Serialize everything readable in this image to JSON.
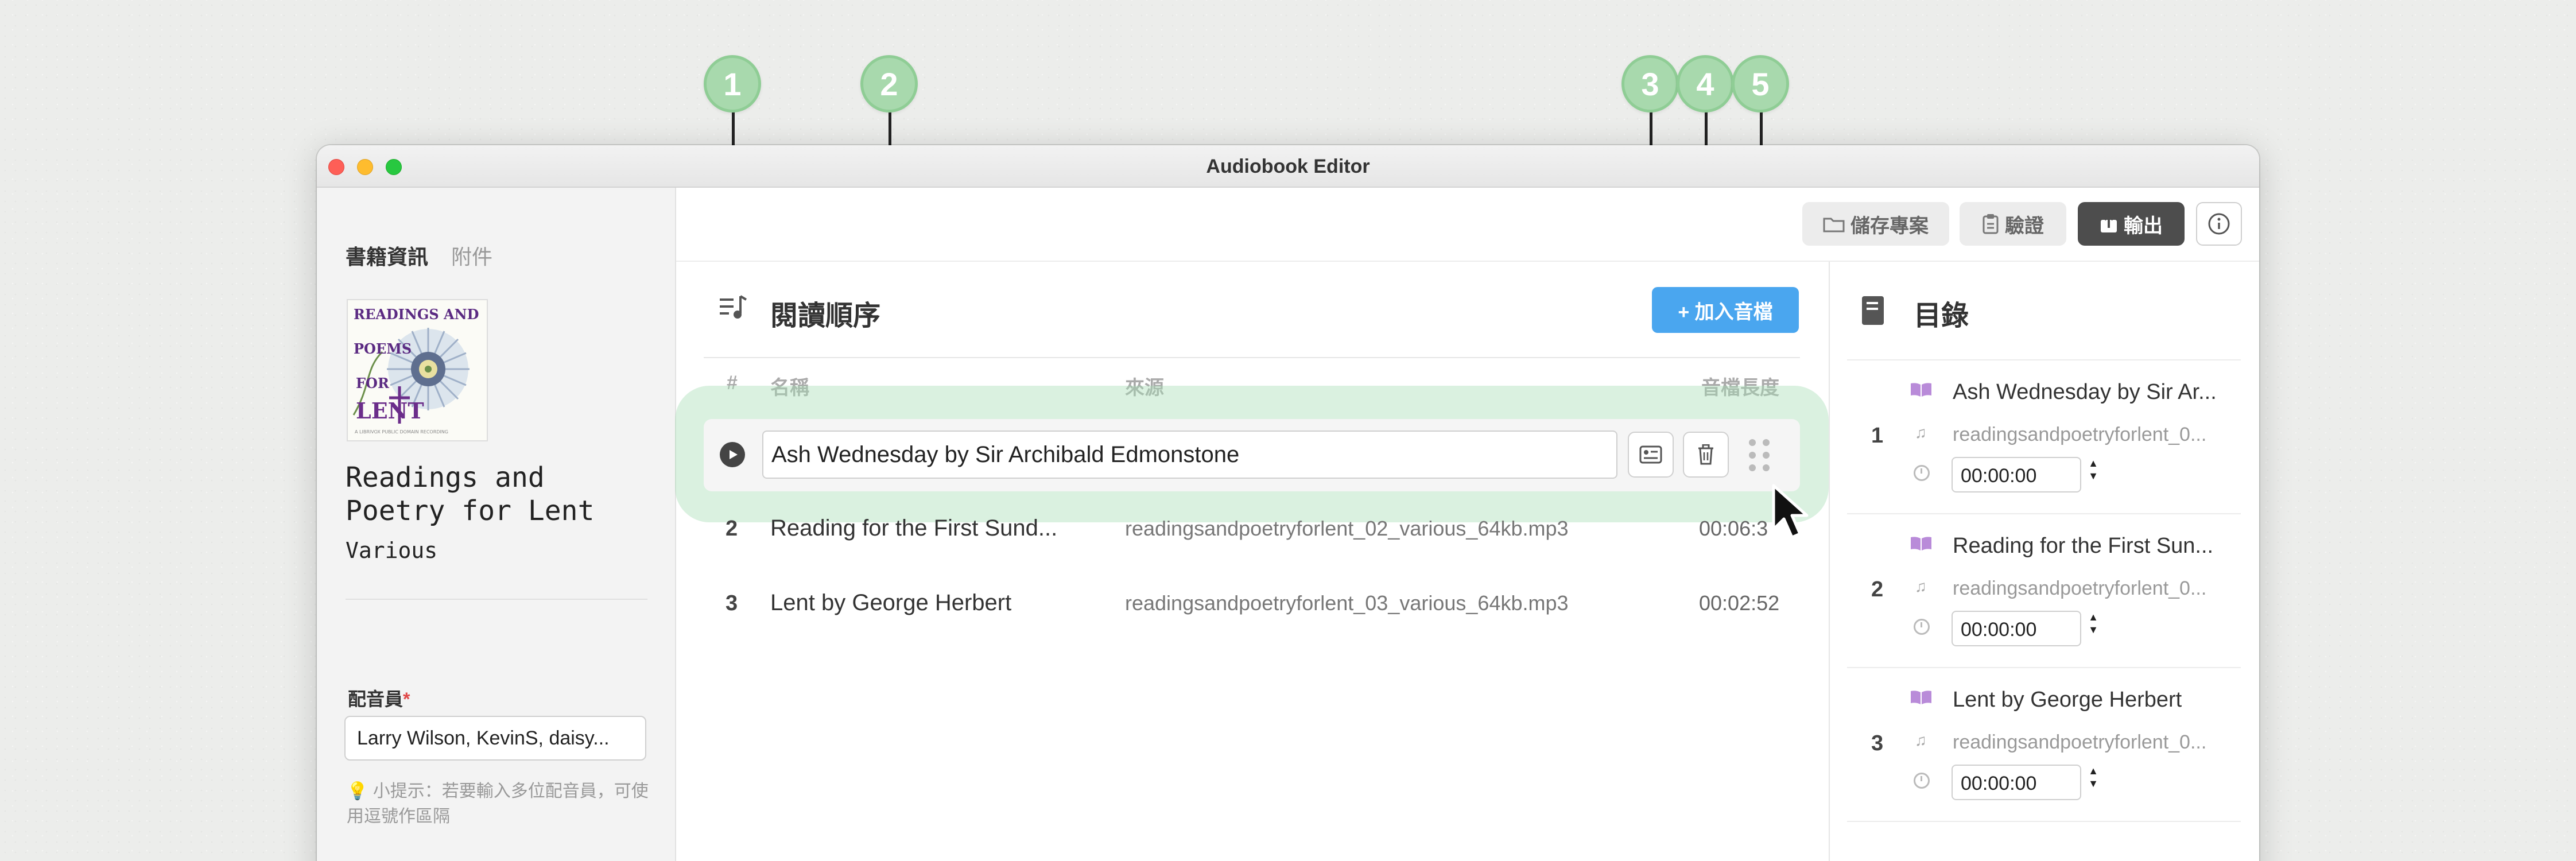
{
  "window": {
    "title": "Audiobook Editor"
  },
  "callouts": [
    "1",
    "2",
    "3",
    "4",
    "5"
  ],
  "toolbar": {
    "save_label": "儲存專案",
    "validate_label": "驗證",
    "export_label": "輸出"
  },
  "sidebar": {
    "tabs": [
      "書籍資訊",
      "附件"
    ],
    "cover": {
      "line1": "READINGS AND",
      "line2": "POEMS",
      "line3": "FOR",
      "line4": "LENT",
      "footer": "A LIBRIVOX PUBLIC DOMAIN RECORDING"
    },
    "book_title": "Readings and Poetry for Lent",
    "author": "Various",
    "narrator_label": "配音員",
    "narrator_required": "*",
    "narrator_value": "Larry Wilson, KevinS, daisy...",
    "tip": "💡 小提示：若要輸入多位配音員，可使用逗號作區隔"
  },
  "reading_order": {
    "title": "閱讀順序",
    "add_button": "+ 加入音檔",
    "columns": {
      "num": "#",
      "name": "名稱",
      "source": "來源",
      "duration": "音檔長度"
    },
    "rows": [
      {
        "num": "1",
        "name": "Ash Wednesday by Sir Archibald Edmonstone",
        "source": "",
        "duration": ""
      },
      {
        "num": "2",
        "name": "Reading for the First Sund...",
        "source": "readingsandpoetryforlent_02_various_64kb.mp3",
        "duration": "00:06:3"
      },
      {
        "num": "3",
        "name": "Lent by George Herbert",
        "source": "readingsandpoetryforlent_03_various_64kb.mp3",
        "duration": "00:02:52"
      }
    ]
  },
  "toc": {
    "title": "目錄",
    "entries": [
      {
        "num": "1",
        "name": "Ash Wednesday by Sir Ar...",
        "file": "readingsandpoetryforlent_0...",
        "time": "00:00:00"
      },
      {
        "num": "2",
        "name": "Reading for the First Sun...",
        "file": "readingsandpoetryforlent_0...",
        "time": "00:00:00"
      },
      {
        "num": "3",
        "name": "Lent by George Herbert",
        "file": "readingsandpoetryforlent_0...",
        "time": "00:00:00"
      }
    ]
  },
  "colors": {
    "accent": "#4aa6ef",
    "highlight": "#a8deb4",
    "callout": "#a8d9ad",
    "book_icon": "#b98bd9"
  }
}
